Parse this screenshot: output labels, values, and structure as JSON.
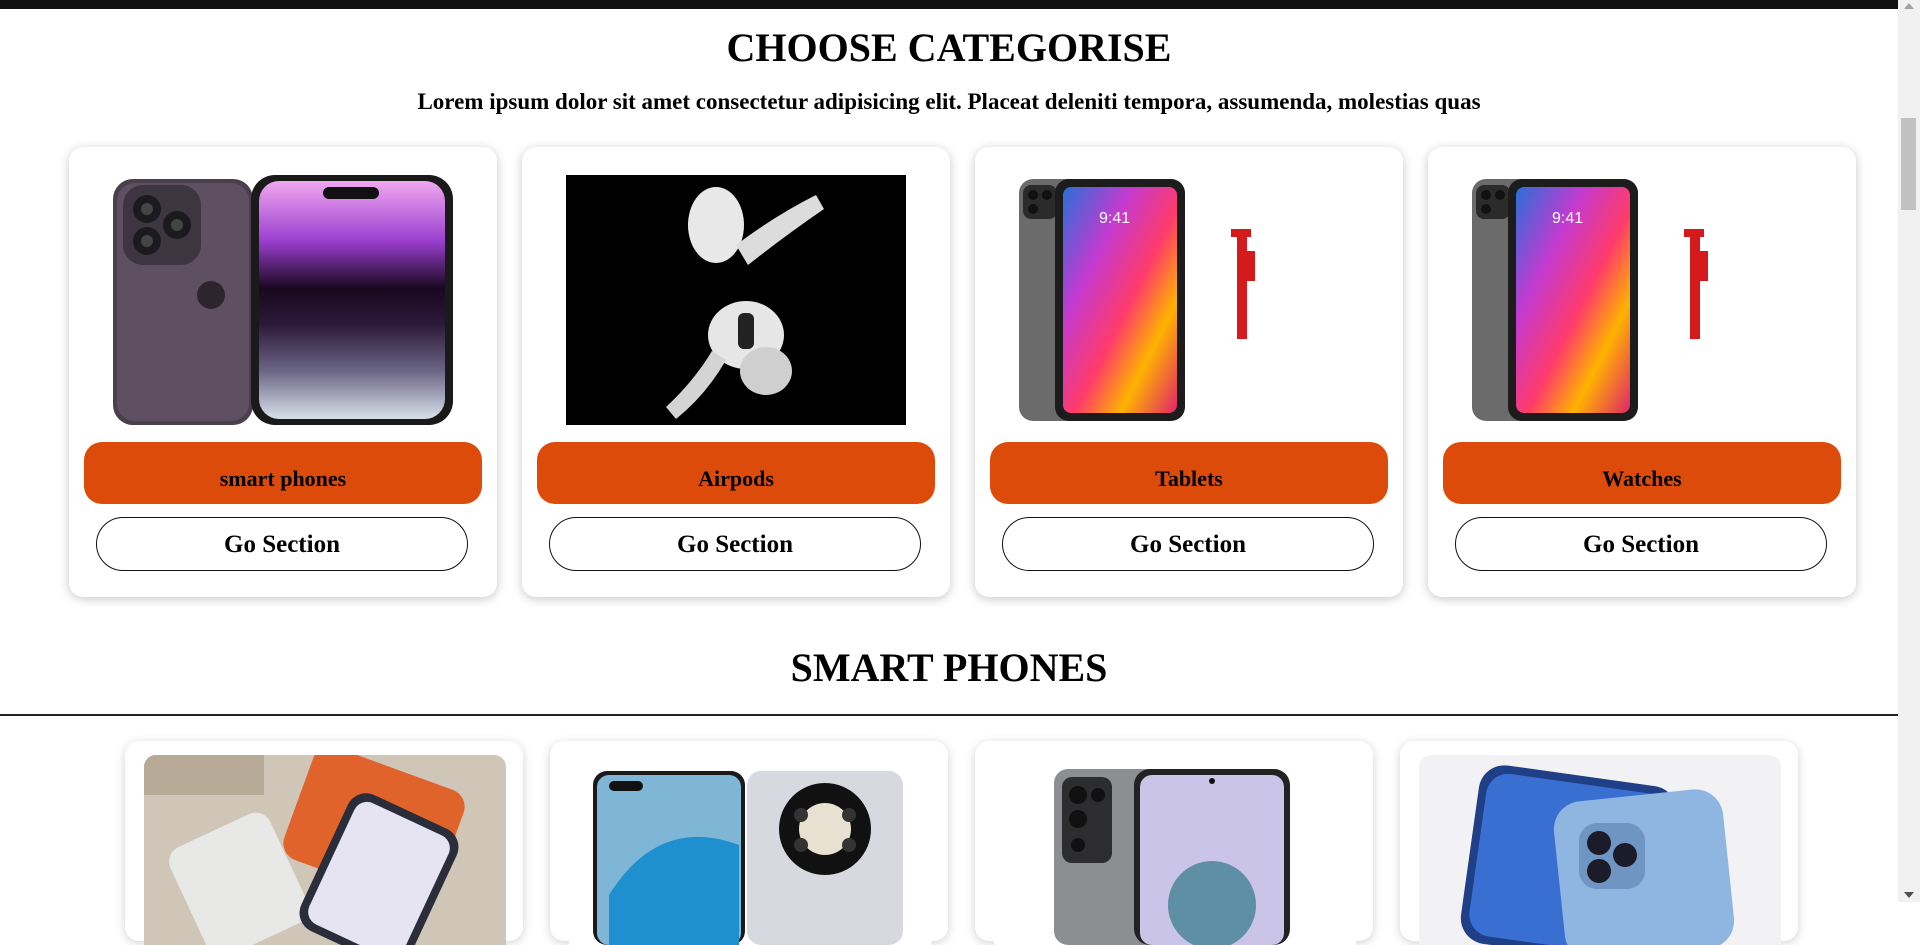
{
  "categories": {
    "heading": "CHOOSE CATEGORISE",
    "description": "Lorem ipsum dolor sit amet consectetur adipisicing elit. Placeat deleniti tempora, assumenda, molestias quas",
    "items": [
      {
        "label": "smart phones",
        "button": "Go Section",
        "image": "iphone-purple-image"
      },
      {
        "label": "Airpods",
        "button": "Go Section",
        "image": "airpods-image"
      },
      {
        "label": "Tablets",
        "button": "Go Section",
        "image": "ipad-image"
      },
      {
        "label": "Watches",
        "button": "Go Section",
        "image": "ipad-image"
      }
    ]
  },
  "smart_phones": {
    "heading": "SMART PHONES",
    "items": [
      {
        "image": "pixel-phones-image"
      },
      {
        "image": "huawei-mate-image"
      },
      {
        "image": "redmi-note-image"
      },
      {
        "image": "iphone-blue-image"
      }
    ]
  },
  "colors": {
    "accent": "#dd4b0b",
    "background": "#ffffff",
    "text": "#000000"
  }
}
